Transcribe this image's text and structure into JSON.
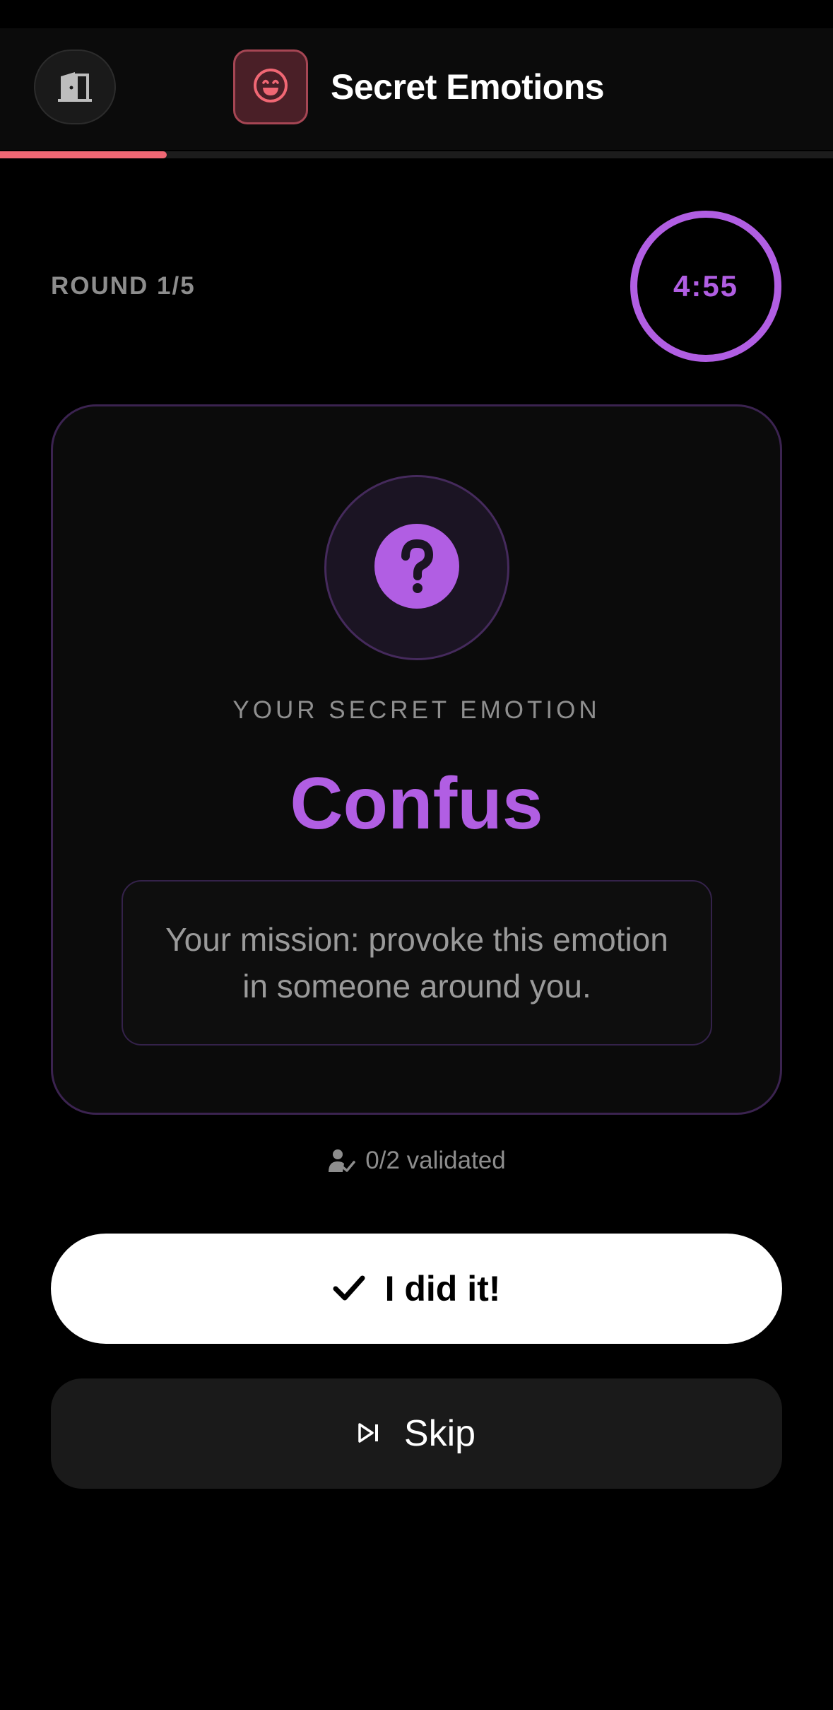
{
  "header": {
    "title": "Secret Emotions",
    "exit_icon": "door-exit-icon",
    "logo_icon": "smiley-face-icon"
  },
  "progress": {
    "fraction": 0.2
  },
  "round": {
    "label": "ROUND 1/5"
  },
  "timer": {
    "value": "4:55"
  },
  "card": {
    "badge_icon": "question-mark-icon",
    "secret_label": "YOUR SECRET EMOTION",
    "emotion": "Confus",
    "mission": "Your mission: provoke this emotion in someone around you."
  },
  "validation": {
    "icon": "user-check-icon",
    "text": "0/2 validated"
  },
  "actions": {
    "done_label": "I did it!",
    "done_icon": "checkmark-icon",
    "skip_label": "Skip",
    "skip_icon": "skip-next-icon"
  },
  "colors": {
    "accent": "#b15ee3",
    "progress": "#f06774",
    "background": "#000000"
  }
}
